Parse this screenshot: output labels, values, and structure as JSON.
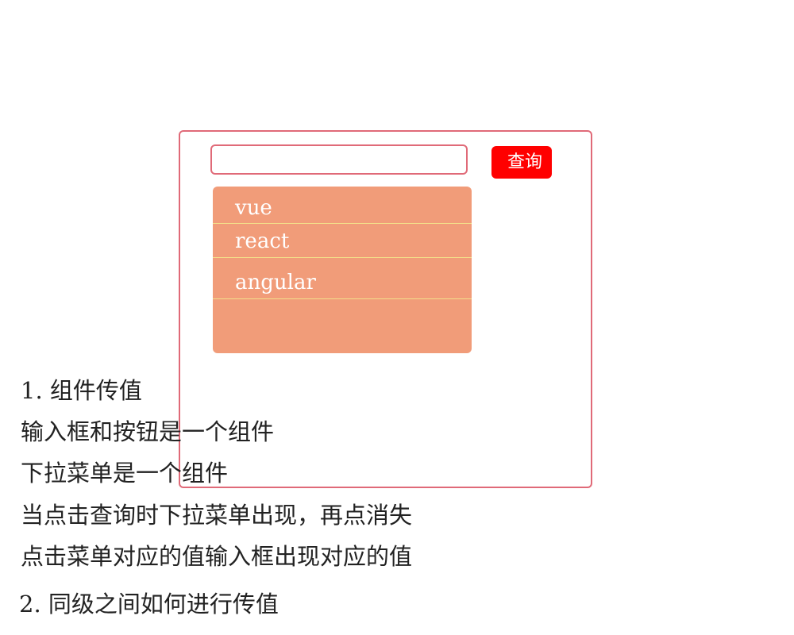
{
  "search": {
    "value": "",
    "placeholder": "",
    "button_label": "查询"
  },
  "dropdown": {
    "items": [
      "vue",
      "react",
      "angular"
    ]
  },
  "notes": [
    "1. 组件传值",
    "输入框和按钮是一个组件",
    "下拉菜单是一个组件",
    "当点击查询时下拉菜单出现，再点消失",
    "点击菜单对应的值输入框出现对应的值",
    "2. 同级之间如何进行传值"
  ],
  "colors": {
    "frame_border": "#e06a78",
    "button_bg": "#ff0000",
    "dropdown_bg": "#f19c79",
    "item_divider": "#f3e08a"
  }
}
